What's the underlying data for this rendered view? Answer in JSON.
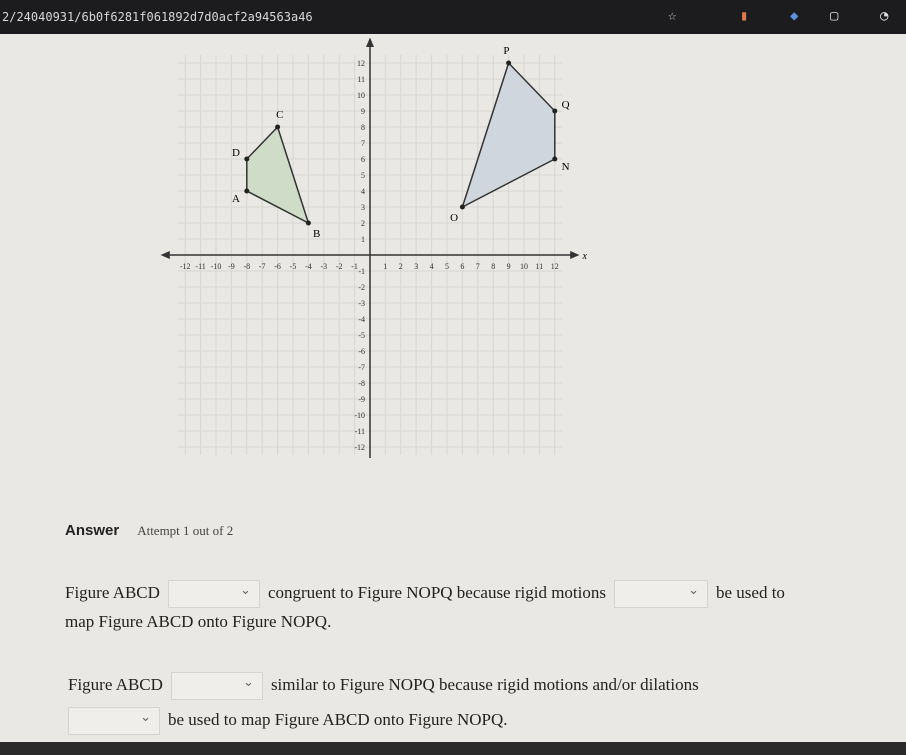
{
  "browser": {
    "url": "2/24040931/6b0f6281f061892d7d0acf2a94563a46",
    "icons": [
      "star-icon",
      "extension-icon",
      "extension-icon-2",
      "square-icon",
      "profile-icon"
    ]
  },
  "graph": {
    "x_axis_label": "x",
    "x_ticks": [
      -12,
      -11,
      -10,
      -9,
      -8,
      -7,
      -6,
      -5,
      -4,
      -3,
      -2,
      -1,
      1,
      2,
      3,
      4,
      5,
      6,
      7,
      8,
      9,
      10,
      11,
      12
    ],
    "y_ticks": [
      -12,
      -11,
      -10,
      -9,
      -8,
      -7,
      -6,
      -5,
      -4,
      -3,
      -2,
      -1,
      1,
      2,
      3,
      4,
      5,
      6,
      7,
      8,
      9,
      10,
      11,
      12
    ],
    "figures": [
      {
        "name": "ABCD",
        "fill": "#cfdcc8",
        "vertices": [
          {
            "label": "A",
            "x": -8,
            "y": 4
          },
          {
            "label": "B",
            "x": -4,
            "y": 2
          },
          {
            "label": "C",
            "x": -6,
            "y": 8
          },
          {
            "label": "D",
            "x": -8,
            "y": 6
          }
        ]
      },
      {
        "name": "NOPQ",
        "fill": "#cfd6dd",
        "vertices": [
          {
            "label": "N",
            "x": 12,
            "y": 6
          },
          {
            "label": "O",
            "x": 6,
            "y": 3
          },
          {
            "label": "P",
            "x": 9,
            "y": 12
          },
          {
            "label": "Q",
            "x": 12,
            "y": 9
          }
        ]
      }
    ]
  },
  "answer": {
    "label": "Answer",
    "attempt": "Attempt 1 out of 2",
    "q1": {
      "a": "Figure ABCD",
      "b": "congruent to Figure NOPQ because rigid motions",
      "c": "be used to",
      "d": "map Figure ABCD onto Figure NOPQ."
    },
    "q2": {
      "a": "Figure ABCD",
      "b": "similar to Figure NOPQ because rigid motions and/or dilations",
      "c": "be used to map Figure ABCD onto Figure NOPQ."
    }
  }
}
